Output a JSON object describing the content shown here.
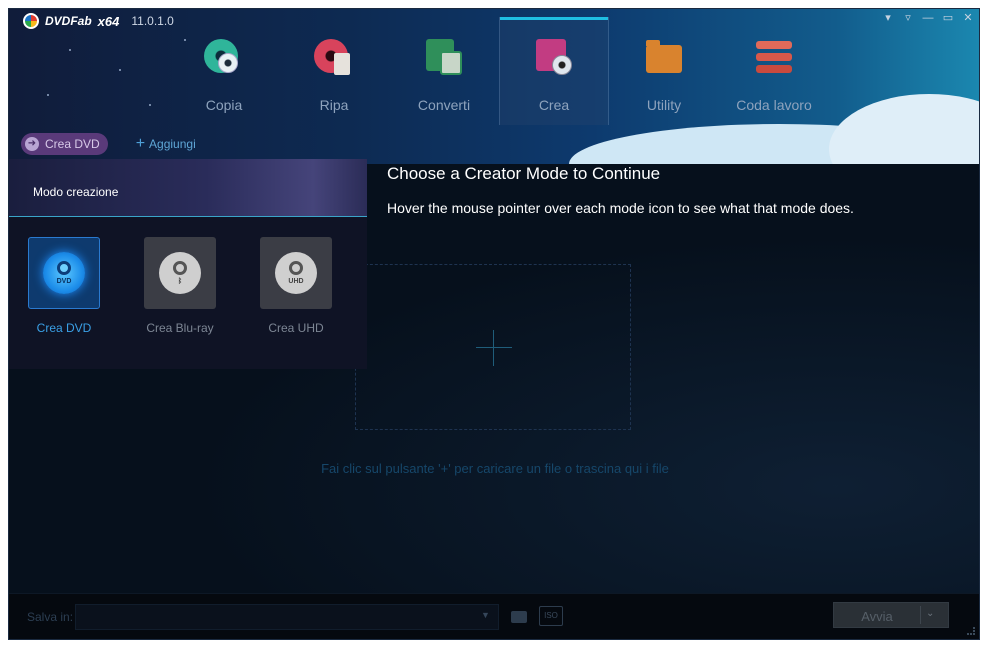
{
  "app": {
    "brand": "DVDFab",
    "arch": "x64",
    "version": "11.0.1.0"
  },
  "window_controls": [
    "pin-icon",
    "menu-icon",
    "minimize-icon",
    "maximize-icon",
    "close-icon"
  ],
  "nav": {
    "active": "Crea",
    "items": [
      {
        "label": "Copia",
        "icon": "copy-disc-icon"
      },
      {
        "label": "Ripa",
        "icon": "ripper-icon"
      },
      {
        "label": "Converti",
        "icon": "converter-icon"
      },
      {
        "label": "Crea",
        "icon": "creator-icon"
      },
      {
        "label": "Utility",
        "icon": "utility-folder-icon"
      },
      {
        "label": "Coda lavoro",
        "icon": "task-queue-icon"
      }
    ]
  },
  "subbar": {
    "mode_button": "Crea DVD",
    "add_button": "Aggiungi"
  },
  "mode_panel": {
    "title": "Modo creazione",
    "options": [
      {
        "label": "Crea DVD",
        "tag": "DVD",
        "selected": true
      },
      {
        "label": "Crea Blu-ray",
        "tag": "",
        "selected": false
      },
      {
        "label": "Crea UHD",
        "tag": "UHD",
        "selected": false
      }
    ]
  },
  "guide": {
    "title": "Choose a Creator Mode to Continue",
    "text": "Hover the mouse pointer over each mode icon to see what that mode does."
  },
  "drop_hint": "Fai clic sul pulsante '+' per caricare un file o trascina qui i file",
  "footer": {
    "save_label": "Salva in:",
    "save_value": "",
    "iso_label": "ISO",
    "start_button": "Avvia"
  },
  "colors": {
    "accent": "#1fbfe3",
    "selected_mode": "#3aa0e6",
    "drop_hint": "#16476a"
  }
}
